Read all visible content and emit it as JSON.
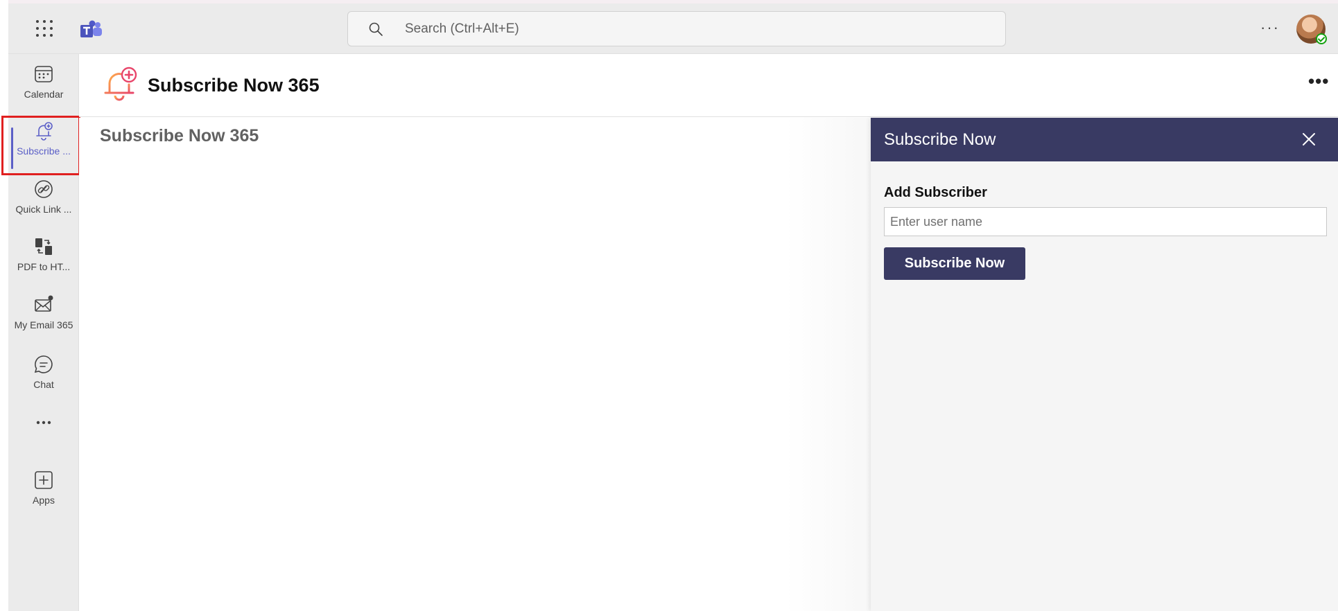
{
  "topbar": {
    "search_placeholder": "Search (Ctrl+Alt+E)",
    "more_label": "···",
    "icons": [
      "app-launcher-icon",
      "teams-logo-icon",
      "search-icon",
      "more-options-icon",
      "avatar",
      "presence-available-icon"
    ]
  },
  "rail": {
    "items": [
      {
        "label": "Calendar",
        "icon": "calendar-icon"
      },
      {
        "label": "Subscribe ...",
        "icon": "bell-plus-icon",
        "active": true
      },
      {
        "label": "Quick Link ...",
        "icon": "link-icon"
      },
      {
        "label": "PDF to HT...",
        "icon": "convert-document-icon"
      },
      {
        "label": "My Email 365",
        "icon": "mail-icon"
      },
      {
        "label": "Chat",
        "icon": "chat-icon"
      },
      {
        "label": "",
        "icon": "more-apps-icon"
      },
      {
        "label": "Apps",
        "icon": "add-app-icon"
      }
    ],
    "more_label": "···"
  },
  "app_header": {
    "title": "Subscribe Now 365",
    "more_label": "•••"
  },
  "content": {
    "title": "Subscribe Now 365"
  },
  "panel": {
    "title": "Subscribe Now",
    "add_label": "Add Subscriber",
    "input_placeholder": "Enter user name",
    "input_value": "",
    "button_label": "Subscribe Now"
  },
  "colors": {
    "accent": "#5b5fc7",
    "panel_header": "#393a63",
    "highlight": "#e02020",
    "rail_bg": "#ebebeb"
  }
}
